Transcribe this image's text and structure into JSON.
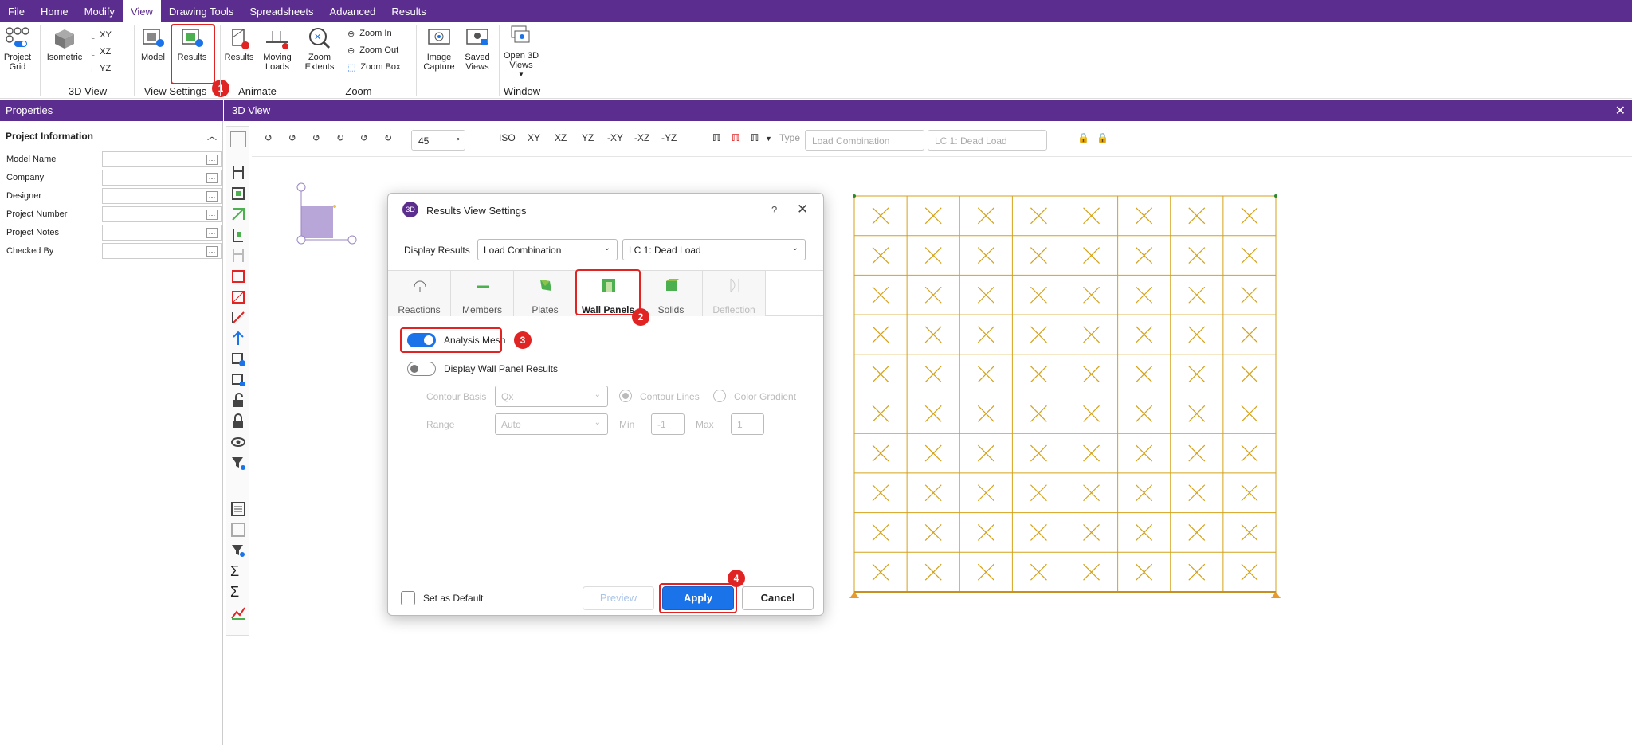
{
  "menu": [
    "File",
    "Home",
    "Modify",
    "View",
    "Drawing Tools",
    "Spreadsheets",
    "Advanced",
    "Results"
  ],
  "menu_active": "View",
  "ribbon": {
    "project_grid": "Project Grid",
    "isometric": "Isometric",
    "xy": "XY",
    "xz": "XZ",
    "yz": "YZ",
    "group_3d_view": "3D View",
    "model": "Model",
    "results": "Results",
    "group_view_settings": "View Settings",
    "animate_results": "Results",
    "moving_loads": "Moving Loads",
    "group_animate": "Animate",
    "zoom_extents": "Zoom Extents",
    "zoom_in": "Zoom In",
    "zoom_out": "Zoom Out",
    "zoom_box": "Zoom Box",
    "group_zoom": "Zoom",
    "image_capture": "Image Capture",
    "saved_views": "Saved Views",
    "open_3d_views": "Open 3D Views",
    "group_window": "Window"
  },
  "badges": {
    "b1": "1",
    "b2": "2",
    "b3": "3",
    "b4": "4"
  },
  "properties": {
    "header": "Properties",
    "section": "Project Information",
    "fields": [
      "Model Name",
      "Company",
      "Designer",
      "Project Number",
      "Project Notes",
      "Checked By"
    ]
  },
  "view": {
    "header": "3D View",
    "angle": "45",
    "angle_unit": "°",
    "views": [
      "ISO",
      "XY",
      "XZ",
      "YZ",
      "-XY",
      "-XZ",
      "-YZ"
    ],
    "type_label": "Type",
    "type_value": "Load Combination",
    "case_value": "LC 1: Dead Load"
  },
  "dialog": {
    "title": "Results View Settings",
    "help": "?",
    "display_results_label": "Display Results",
    "display_results_value": "Load Combination",
    "case_value": "LC 1: Dead Load",
    "tabs": [
      "Reactions",
      "Members",
      "Plates",
      "Wall Panels",
      "Solids",
      "Deflection"
    ],
    "active_tab": "Wall Panels",
    "analysis_mesh": "Analysis Mesh",
    "analysis_mesh_on": true,
    "display_wall_panel_results": "Display Wall Panel Results",
    "display_wall_panel_results_on": false,
    "contour_basis_label": "Contour Basis",
    "contour_basis_value": "Qx",
    "contour_lines": "Contour Lines",
    "color_gradient": "Color Gradient",
    "range_label": "Range",
    "range_value": "Auto",
    "min_label": "Min",
    "min_value": "-1",
    "max_label": "Max",
    "max_value": "1",
    "set_as_default": "Set as Default",
    "preview": "Preview",
    "apply": "Apply",
    "cancel": "Cancel"
  },
  "mesh": {
    "cols": 8,
    "rows": 10
  },
  "colors": {
    "brand": "#5b2d8e",
    "accent": "#1a73e8",
    "mesh": "#d4a21a",
    "highlight": "#e02424"
  }
}
